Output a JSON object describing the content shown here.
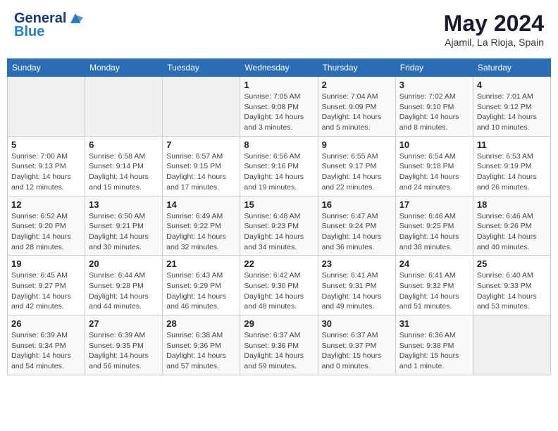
{
  "header": {
    "logo_general": "General",
    "logo_blue": "Blue",
    "month_year": "May 2024",
    "location": "Ajamil, La Rioja, Spain"
  },
  "weekdays": [
    "Sunday",
    "Monday",
    "Tuesday",
    "Wednesday",
    "Thursday",
    "Friday",
    "Saturday"
  ],
  "weeks": [
    [
      {
        "day": "",
        "sunrise": "",
        "sunset": "",
        "daylight": ""
      },
      {
        "day": "",
        "sunrise": "",
        "sunset": "",
        "daylight": ""
      },
      {
        "day": "",
        "sunrise": "",
        "sunset": "",
        "daylight": ""
      },
      {
        "day": "1",
        "sunrise": "Sunrise: 7:05 AM",
        "sunset": "Sunset: 9:08 PM",
        "daylight": "Daylight: 14 hours and 3 minutes."
      },
      {
        "day": "2",
        "sunrise": "Sunrise: 7:04 AM",
        "sunset": "Sunset: 9:09 PM",
        "daylight": "Daylight: 14 hours and 5 minutes."
      },
      {
        "day": "3",
        "sunrise": "Sunrise: 7:02 AM",
        "sunset": "Sunset: 9:10 PM",
        "daylight": "Daylight: 14 hours and 8 minutes."
      },
      {
        "day": "4",
        "sunrise": "Sunrise: 7:01 AM",
        "sunset": "Sunset: 9:12 PM",
        "daylight": "Daylight: 14 hours and 10 minutes."
      }
    ],
    [
      {
        "day": "5",
        "sunrise": "Sunrise: 7:00 AM",
        "sunset": "Sunset: 9:13 PM",
        "daylight": "Daylight: 14 hours and 12 minutes."
      },
      {
        "day": "6",
        "sunrise": "Sunrise: 6:58 AM",
        "sunset": "Sunset: 9:14 PM",
        "daylight": "Daylight: 14 hours and 15 minutes."
      },
      {
        "day": "7",
        "sunrise": "Sunrise: 6:57 AM",
        "sunset": "Sunset: 9:15 PM",
        "daylight": "Daylight: 14 hours and 17 minutes."
      },
      {
        "day": "8",
        "sunrise": "Sunrise: 6:56 AM",
        "sunset": "Sunset: 9:16 PM",
        "daylight": "Daylight: 14 hours and 19 minutes."
      },
      {
        "day": "9",
        "sunrise": "Sunrise: 6:55 AM",
        "sunset": "Sunset: 9:17 PM",
        "daylight": "Daylight: 14 hours and 22 minutes."
      },
      {
        "day": "10",
        "sunrise": "Sunrise: 6:54 AM",
        "sunset": "Sunset: 9:18 PM",
        "daylight": "Daylight: 14 hours and 24 minutes."
      },
      {
        "day": "11",
        "sunrise": "Sunrise: 6:53 AM",
        "sunset": "Sunset: 9:19 PM",
        "daylight": "Daylight: 14 hours and 26 minutes."
      }
    ],
    [
      {
        "day": "12",
        "sunrise": "Sunrise: 6:52 AM",
        "sunset": "Sunset: 9:20 PM",
        "daylight": "Daylight: 14 hours and 28 minutes."
      },
      {
        "day": "13",
        "sunrise": "Sunrise: 6:50 AM",
        "sunset": "Sunset: 9:21 PM",
        "daylight": "Daylight: 14 hours and 30 minutes."
      },
      {
        "day": "14",
        "sunrise": "Sunrise: 6:49 AM",
        "sunset": "Sunset: 9:22 PM",
        "daylight": "Daylight: 14 hours and 32 minutes."
      },
      {
        "day": "15",
        "sunrise": "Sunrise: 6:48 AM",
        "sunset": "Sunset: 9:23 PM",
        "daylight": "Daylight: 14 hours and 34 minutes."
      },
      {
        "day": "16",
        "sunrise": "Sunrise: 6:47 AM",
        "sunset": "Sunset: 9:24 PM",
        "daylight": "Daylight: 14 hours and 36 minutes."
      },
      {
        "day": "17",
        "sunrise": "Sunrise: 6:46 AM",
        "sunset": "Sunset: 9:25 PM",
        "daylight": "Daylight: 14 hours and 38 minutes."
      },
      {
        "day": "18",
        "sunrise": "Sunrise: 6:46 AM",
        "sunset": "Sunset: 9:26 PM",
        "daylight": "Daylight: 14 hours and 40 minutes."
      }
    ],
    [
      {
        "day": "19",
        "sunrise": "Sunrise: 6:45 AM",
        "sunset": "Sunset: 9:27 PM",
        "daylight": "Daylight: 14 hours and 42 minutes."
      },
      {
        "day": "20",
        "sunrise": "Sunrise: 6:44 AM",
        "sunset": "Sunset: 9:28 PM",
        "daylight": "Daylight: 14 hours and 44 minutes."
      },
      {
        "day": "21",
        "sunrise": "Sunrise: 6:43 AM",
        "sunset": "Sunset: 9:29 PM",
        "daylight": "Daylight: 14 hours and 46 minutes."
      },
      {
        "day": "22",
        "sunrise": "Sunrise: 6:42 AM",
        "sunset": "Sunset: 9:30 PM",
        "daylight": "Daylight: 14 hours and 48 minutes."
      },
      {
        "day": "23",
        "sunrise": "Sunrise: 6:41 AM",
        "sunset": "Sunset: 9:31 PM",
        "daylight": "Daylight: 14 hours and 49 minutes."
      },
      {
        "day": "24",
        "sunrise": "Sunrise: 6:41 AM",
        "sunset": "Sunset: 9:32 PM",
        "daylight": "Daylight: 14 hours and 51 minutes."
      },
      {
        "day": "25",
        "sunrise": "Sunrise: 6:40 AM",
        "sunset": "Sunset: 9:33 PM",
        "daylight": "Daylight: 14 hours and 53 minutes."
      }
    ],
    [
      {
        "day": "26",
        "sunrise": "Sunrise: 6:39 AM",
        "sunset": "Sunset: 9:34 PM",
        "daylight": "Daylight: 14 hours and 54 minutes."
      },
      {
        "day": "27",
        "sunrise": "Sunrise: 6:39 AM",
        "sunset": "Sunset: 9:35 PM",
        "daylight": "Daylight: 14 hours and 56 minutes."
      },
      {
        "day": "28",
        "sunrise": "Sunrise: 6:38 AM",
        "sunset": "Sunset: 9:36 PM",
        "daylight": "Daylight: 14 hours and 57 minutes."
      },
      {
        "day": "29",
        "sunrise": "Sunrise: 6:37 AM",
        "sunset": "Sunset: 9:36 PM",
        "daylight": "Daylight: 14 hours and 59 minutes."
      },
      {
        "day": "30",
        "sunrise": "Sunrise: 6:37 AM",
        "sunset": "Sunset: 9:37 PM",
        "daylight": "Daylight: 15 hours and 0 minutes."
      },
      {
        "day": "31",
        "sunrise": "Sunrise: 6:36 AM",
        "sunset": "Sunset: 9:38 PM",
        "daylight": "Daylight: 15 hours and 1 minute."
      },
      {
        "day": "",
        "sunrise": "",
        "sunset": "",
        "daylight": ""
      }
    ]
  ]
}
